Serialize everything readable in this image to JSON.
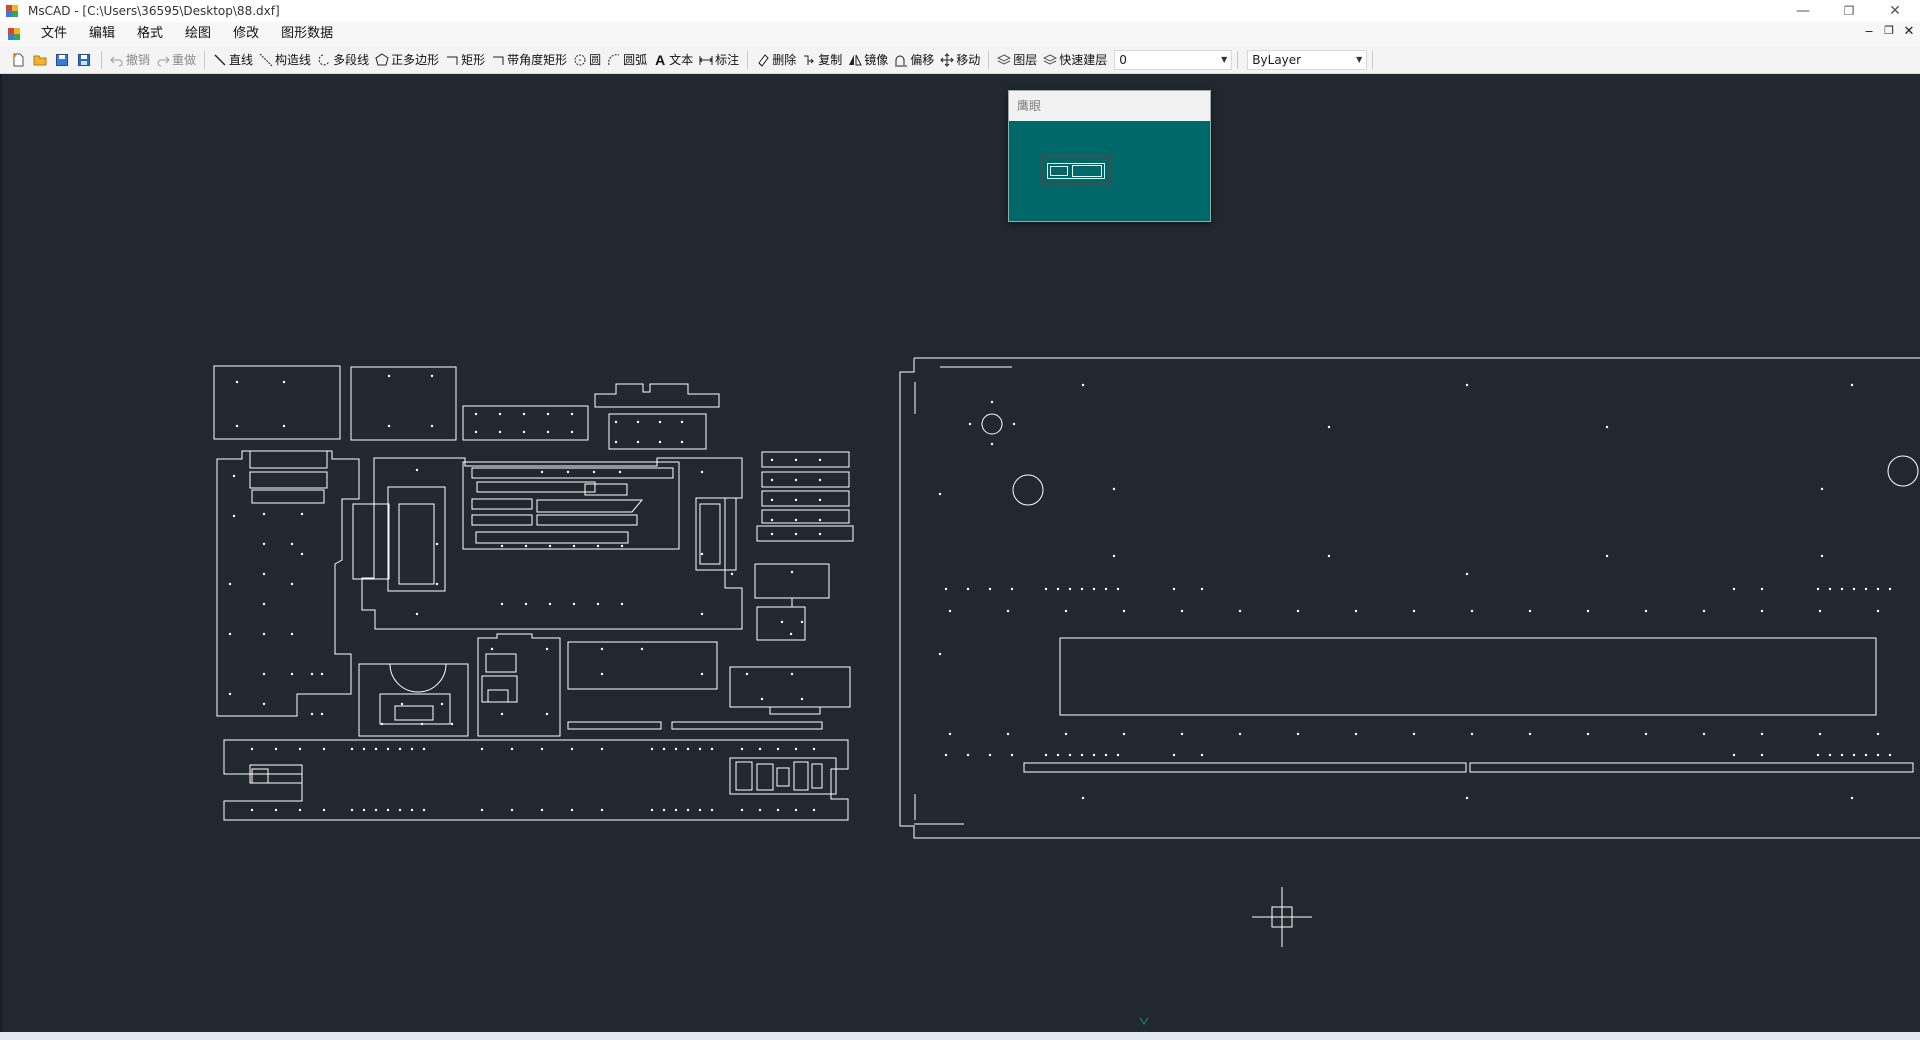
{
  "window": {
    "title": "MsCAD - [C:\\Users\\36595\\Desktop\\88.dxf]",
    "minimize": "—",
    "restore": "❐",
    "close": "✕"
  },
  "menu": {
    "items": [
      {
        "label": "文件",
        "key": "file"
      },
      {
        "label": "编辑",
        "key": "edit"
      },
      {
        "label": "格式",
        "key": "format"
      },
      {
        "label": "绘图",
        "key": "draw"
      },
      {
        "label": "修改",
        "key": "modify"
      },
      {
        "label": "图形数据",
        "key": "shape-data"
      }
    ],
    "mdi_minimize": "‒",
    "mdi_restore": "❐",
    "mdi_close": "✕"
  },
  "toolbar": {
    "undo": "撤销",
    "redo": "重做",
    "line": "直线",
    "construction_line": "构造线",
    "polyline": "多段线",
    "polygon": "正多边形",
    "rectangle": "矩形",
    "chamfer_rect": "带角度矩形",
    "circle": "圆",
    "arc": "圆弧",
    "text": "文本",
    "dimension": "标注",
    "delete": "删除",
    "copy": "复制",
    "mirror": "镜像",
    "offset": "偏移",
    "move": "移动",
    "layer": "图层",
    "quick_layer": "快速建层",
    "layer_value": "0",
    "linetype_value": "ByLayer"
  },
  "eagle_eye": {
    "title": "鹰眼"
  },
  "colors": {
    "canvas_bg": "#212830",
    "entity_stroke": "#ffffff",
    "eagle_bg": "#006868",
    "axis_marker": "#2e8b57"
  },
  "icons": [
    "new-file-icon",
    "open-folder-icon",
    "save-icon",
    "save-as-icon",
    "undo-icon",
    "redo-icon",
    "line-icon",
    "construction-line-icon",
    "polyline-icon",
    "polygon-icon",
    "rectangle-icon",
    "chamfer-rect-icon",
    "circle-icon",
    "arc-icon",
    "text-icon",
    "dimension-icon",
    "delete-icon",
    "copy-icon",
    "mirror-icon",
    "offset-icon",
    "move-icon",
    "layer-icon",
    "quick-layer-icon",
    "crosshair-cursor-icon"
  ]
}
